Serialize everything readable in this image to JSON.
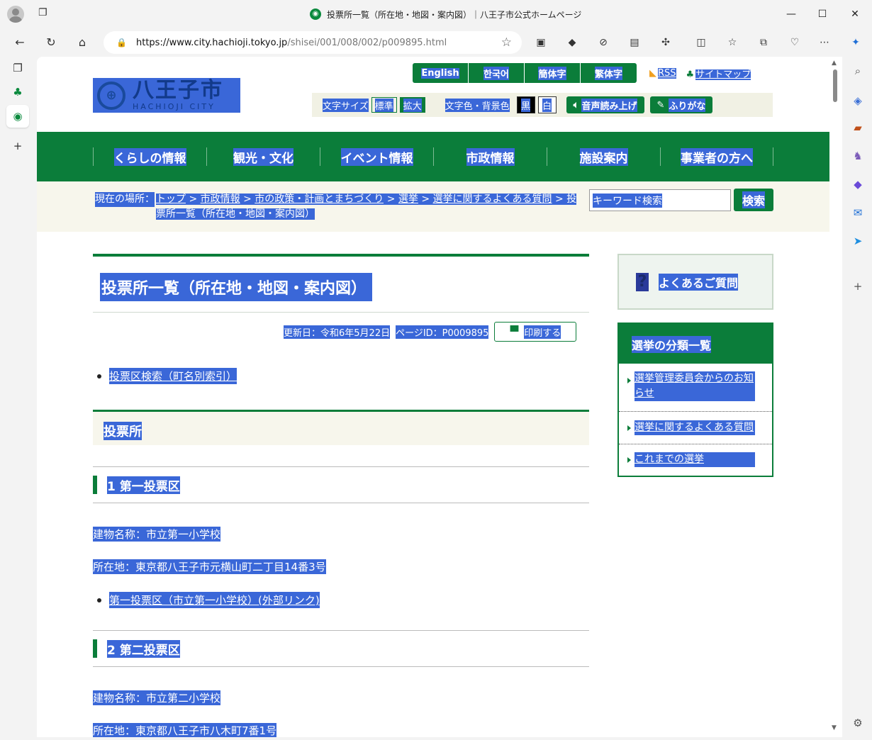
{
  "browser": {
    "tab_title": "投票所一覧（所在地・地図・案内図）｜八王子市公式ホームページ",
    "url_host": "https://www.city.hachioji.tokyo.jp",
    "url_path": "/shisei/001/008/002/p009895.html",
    "extensions": [
      "se-icon",
      "bookmark-arrow-icon",
      "block-icon",
      "screen-icon",
      "puzzle-icon",
      "split-screen-icon",
      "favorites-icon",
      "collections-icon",
      "heart-monitor-icon",
      "more-icon",
      "copilot-icon"
    ],
    "sidebar_right": [
      "search-icon",
      "tag-icon",
      "briefcase-icon",
      "games-icon",
      "m365-icon",
      "outlook-icon",
      "send-icon",
      "add-icon",
      "settings-icon"
    ]
  },
  "site": {
    "logo_jp": "八王子市",
    "logo_en": "HACHIOJI CITY",
    "langs": [
      "English",
      "한국어",
      "簡体字",
      "繁体字"
    ],
    "rss": "RSS",
    "sitemap": "サイトマップ",
    "tools": {
      "font_size_label": "文字サイズ",
      "standard": "標準",
      "large": "拡大",
      "color_label": "文字色・背景色",
      "black": "黒",
      "white": "白",
      "read_aloud": "音声読み上げ",
      "furigana": "ふりがな"
    },
    "nav": [
      "くらしの情報",
      "観光・文化",
      "イベント情報",
      "市政情報",
      "施設案内",
      "事業者の方へ"
    ],
    "breadcrumb_label": "現在の場所：",
    "breadcrumb_links": [
      "トップ",
      "市政情報",
      "市の政策・計画とまちづくり",
      "選挙",
      "選挙に関するよくある質問"
    ],
    "breadcrumb_current": "投票所一覧（所在地・地図・案内図）",
    "search_placeholder": "キーワード検索",
    "search_button": "検索"
  },
  "main": {
    "title": "投票所一覧（所在地・地図・案内図）",
    "updated": "更新日：令和6年5月22日",
    "page_id": "ページID：P0009895",
    "print": "印刷する",
    "index_link": "投票区検索（町名別索引）",
    "section": "投票所",
    "districts": [
      {
        "heading": "1 第一投票区",
        "building": "建物名称：市立第一小学校",
        "address": "所在地：東京都八王子市元横山町二丁目14番3号",
        "link": "第一投票区（市立第一小学校）(外部リンク)"
      },
      {
        "heading": "2 第二投票区",
        "building": "建物名称：市立第二小学校",
        "address": "所在地：東京都八王子市八木町7番1号"
      }
    ]
  },
  "side": {
    "faq": "よくあるご質問",
    "category_title": "選挙の分類一覧",
    "categories": [
      "選挙管理委員会からのお知らせ",
      "選挙に関するよくある質問",
      "これまでの選挙"
    ]
  }
}
